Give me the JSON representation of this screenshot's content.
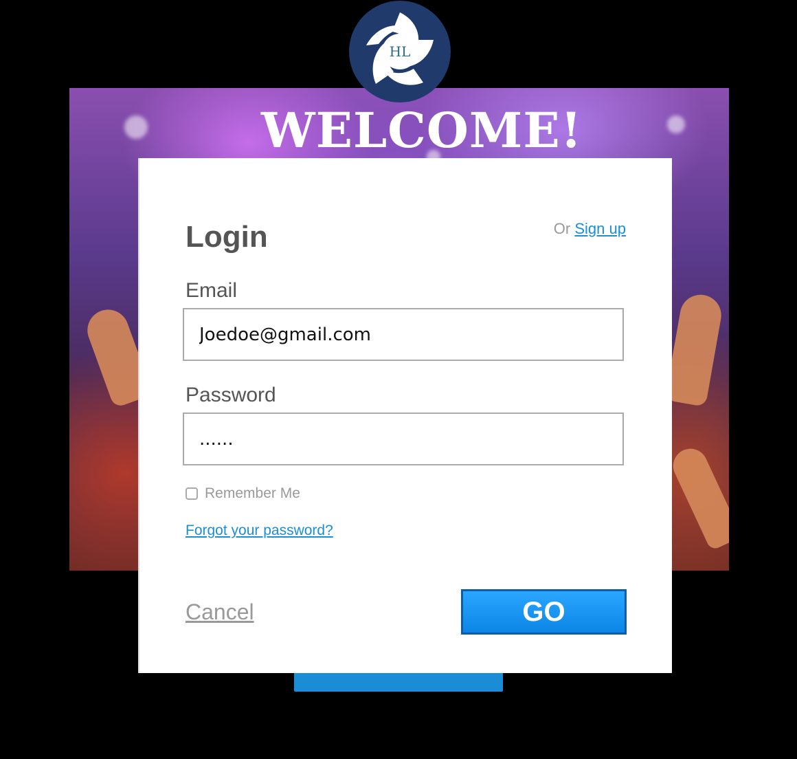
{
  "hero": {
    "heading": "WELCOME!",
    "logo_text": "HL"
  },
  "form": {
    "title": "Login",
    "signup_prefix": "Or",
    "signup_link": "Sign up",
    "email_label": "Email",
    "email_value": "Joedoe@gmail.com",
    "password_label": "Password",
    "password_value": "......",
    "remember_label": "Remember Me",
    "forgot_link": "Forgot your password?",
    "cancel_label": "Cancel",
    "go_label": "GO"
  },
  "colors": {
    "link": "#1a8ed6",
    "button": "#0c86e6",
    "logo_bg": "#1f3a6b"
  }
}
